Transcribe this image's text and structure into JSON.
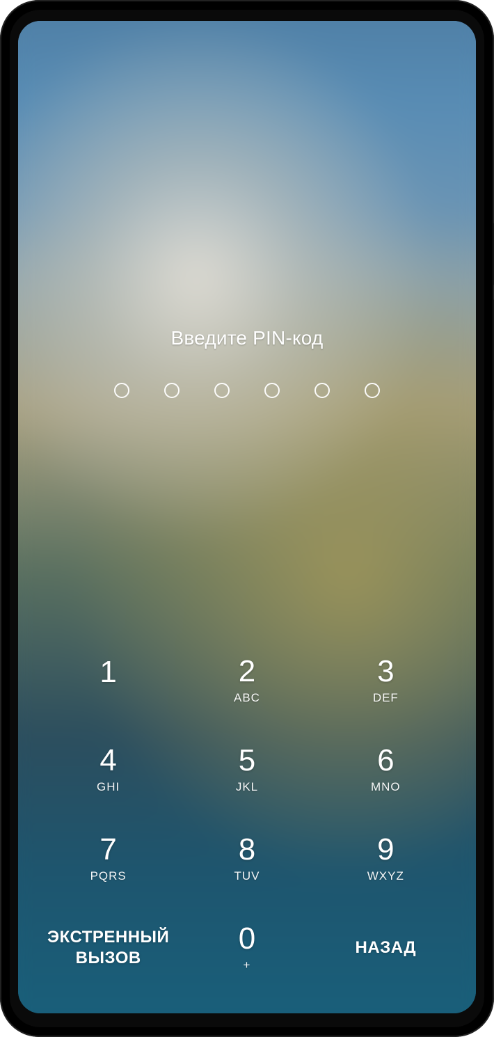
{
  "prompt": "Введите PIN-код",
  "pin_length": 6,
  "keypad": {
    "keys": [
      {
        "digit": "1",
        "letters": ""
      },
      {
        "digit": "2",
        "letters": "ABC"
      },
      {
        "digit": "3",
        "letters": "DEF"
      },
      {
        "digit": "4",
        "letters": "GHI"
      },
      {
        "digit": "5",
        "letters": "JKL"
      },
      {
        "digit": "6",
        "letters": "MNO"
      },
      {
        "digit": "7",
        "letters": "PQRS"
      },
      {
        "digit": "8",
        "letters": "TUV"
      },
      {
        "digit": "9",
        "letters": "WXYZ"
      }
    ],
    "zero": {
      "digit": "0",
      "letters": "+"
    },
    "emergency_label": "ЭКСТРЕННЫЙ\nВЫЗОВ",
    "back_label": "НАЗАД"
  }
}
